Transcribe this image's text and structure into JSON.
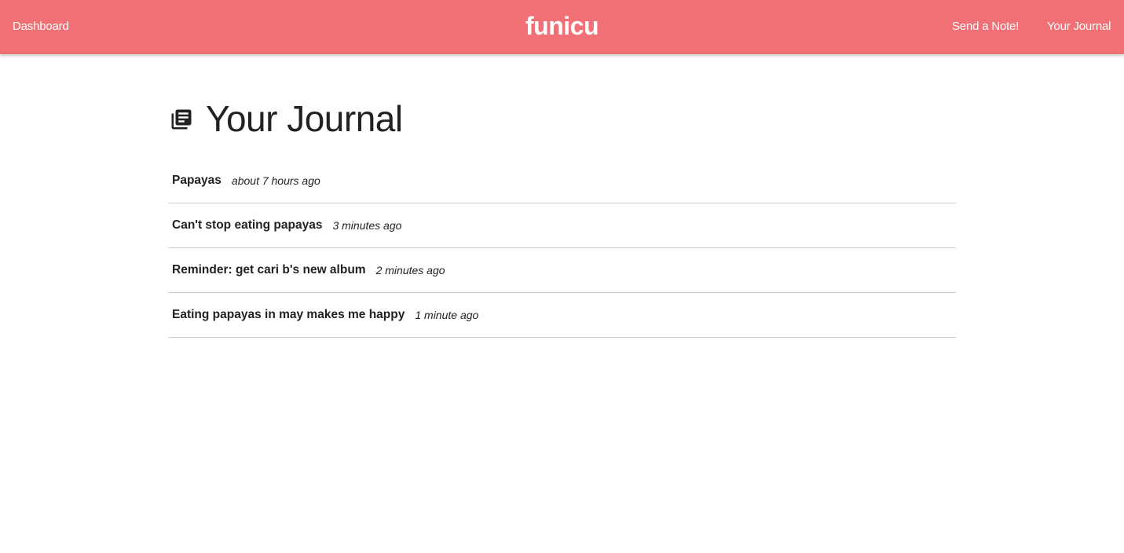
{
  "nav": {
    "dashboard": "Dashboard",
    "brand": "funicu",
    "send_note": "Send a Note!",
    "your_journal": "Your Journal"
  },
  "page": {
    "title": "Your Journal",
    "icon": "journal-icon"
  },
  "entries": [
    {
      "title": "Papayas",
      "time": "about 7 hours ago"
    },
    {
      "title": "Can't stop eating papayas",
      "time": "3 minutes ago"
    },
    {
      "title": "Reminder: get cari b's new album",
      "time": "2 minutes ago"
    },
    {
      "title": "Eating papayas in may makes me happy",
      "time": "1 minute ago"
    }
  ],
  "colors": {
    "navbar": "#f07075",
    "text": "#222222",
    "divider": "#cccccc"
  }
}
